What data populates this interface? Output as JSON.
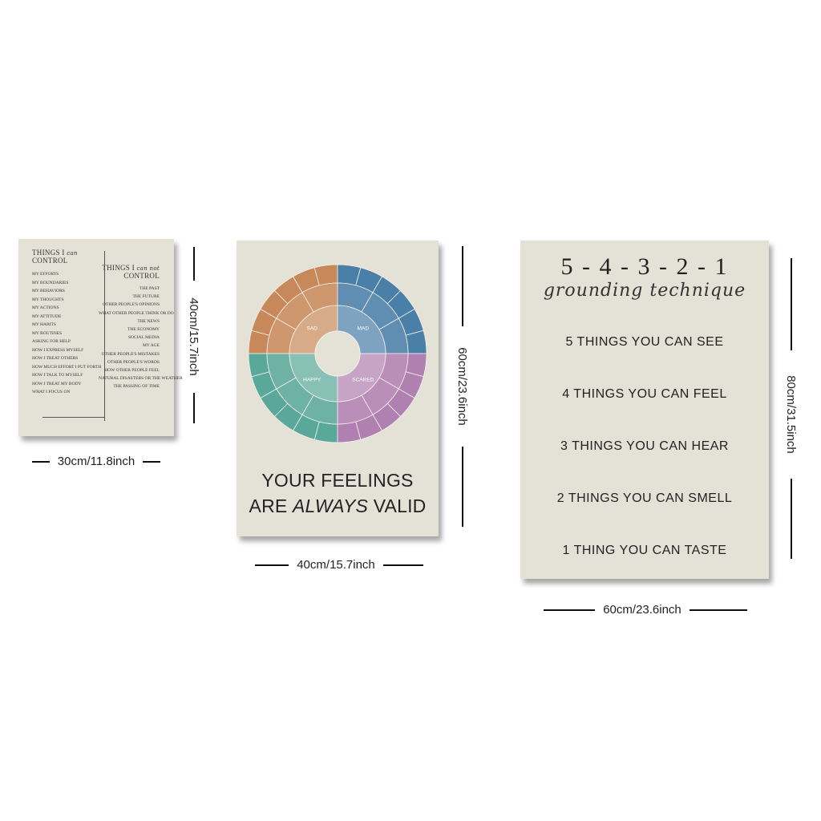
{
  "poster1": {
    "title_left_main": "THINGS I",
    "title_left_script": "can",
    "title_left_sub": "CONTROL",
    "title_right_main": "THINGS I",
    "title_right_script": "can not",
    "title_right_sub": "CONTROL",
    "left_items": [
      "MY EFFORTS",
      "MY BOUNDARIES",
      "MY BEHAVIORS",
      "MY THOUGHTS",
      "MY ACTIONS",
      "MY ATTITUDE",
      "MY HABITS",
      "MY ROUTINES",
      "ASKING FOR HELP",
      "HOW I EXPRESS MYSELF",
      "HOW I TREAT OTHERS",
      "HOW MUCH EFFORT I PUT FORTH",
      "HOW I TALK TO MYSELF",
      "HOW I TREAT MY BODY",
      "WHAT I FOCUS ON"
    ],
    "right_items": [
      "THE PAST",
      "THE FUTURE",
      "OTHER PEOPLE'S OPINIONS",
      "WHAT OTHER PEOPLE THINK OR DO",
      "THE NEWS",
      "THE ECONOMY",
      "SOCIAL MEDIA",
      "MY AGE",
      "OTHER PEOPLE'S MISTAKES",
      "OTHER PEOPLE'S WORDS",
      "HOW OTHER PEOPLE FEEL",
      "NATURAL DISASTERS OR THE WEATHER",
      "THE PASSING OF TIME"
    ]
  },
  "poster2": {
    "caption_line1": "YOUR FEELINGS",
    "caption_line2_a": "ARE ",
    "caption_line2_b": "ALWAYS",
    "caption_line2_c": " VALID",
    "wheel": {
      "core": [
        "SAD",
        "MAD",
        "HAPPY",
        "SCARED"
      ],
      "colors": [
        "#c8895a",
        "#4a7fa8",
        "#5aa89a",
        "#b080b0"
      ]
    }
  },
  "poster3": {
    "countdown": "5 - 4 - 3 - 2 - 1",
    "subtitle": "grounding technique",
    "items": [
      "5 THINGS YOU CAN SEE",
      "4 THINGS YOU CAN FEEL",
      "3 THINGS YOU CAN HEAR",
      "2 THINGS YOU CAN SMELL",
      "1 THING YOU CAN TASTE"
    ]
  },
  "dimensions": {
    "p1_width": "30cm/11.8inch",
    "p1_height": "40cm/15.7inch",
    "p2_width": "40cm/15.7inch",
    "p2_height": "60cm/23.6inch",
    "p3_width": "60cm/23.6inch",
    "p3_height": "80cm/31.5inch"
  }
}
